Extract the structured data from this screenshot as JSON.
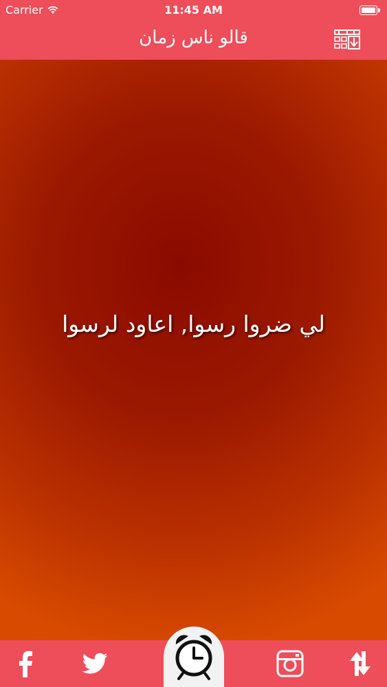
{
  "status": {
    "carrier": "Carrier",
    "time": "11:45 AM"
  },
  "nav": {
    "title": "قالو ناس زمان",
    "action_icon": "grid-download-icon"
  },
  "quote": {
    "text": "لي ضروا رسوا, اعاود لرسوا"
  },
  "toolbar": {
    "items": [
      {
        "icon": "facebook-icon"
      },
      {
        "icon": "twitter-icon"
      },
      {
        "icon": "alarm-clock-icon"
      },
      {
        "icon": "instagram-icon"
      },
      {
        "icon": "shuffle-arrows-icon"
      }
    ]
  },
  "colors": {
    "bar": "#ee4d5a",
    "center_tab": "#f2f2f2",
    "text": "#ffffff"
  }
}
